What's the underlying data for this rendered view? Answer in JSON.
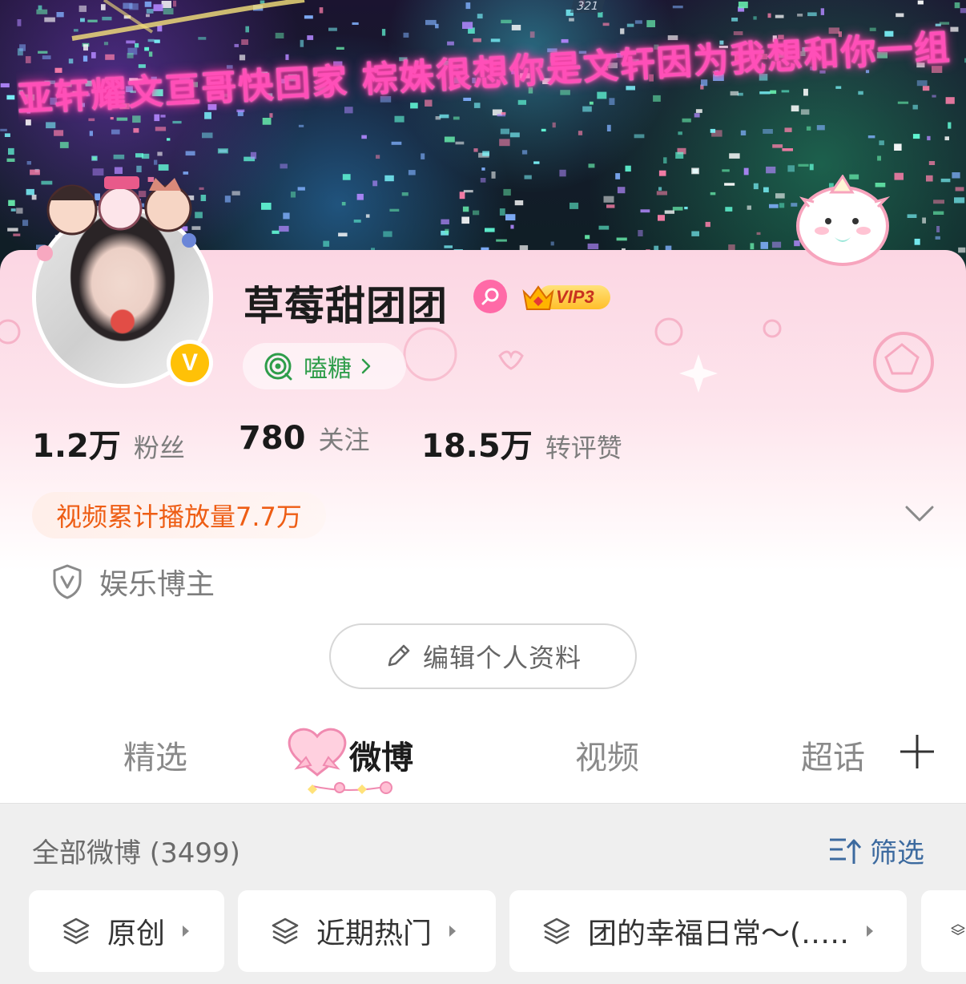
{
  "banner": {
    "slogan": "亚轩耀文亘哥快回家 棕姝很想你是文轩因为我想和你一组",
    "stand_number": "321"
  },
  "profile": {
    "name": "草莓甜团团",
    "gender_icon": "female-icon",
    "vip_label": "VIP3",
    "verified_badge": "V",
    "candy_label": "嗑糖",
    "stats": [
      {
        "value": "1.2万",
        "label": "粉丝"
      },
      {
        "value": "780",
        "label": "关注"
      },
      {
        "value": "18.5万",
        "label": "转评赞"
      }
    ],
    "video_plays": "视频累计播放量7.7万",
    "role": "娱乐博主",
    "edit_button": "编辑个人资料"
  },
  "tabs": [
    {
      "label": "精选",
      "active": false
    },
    {
      "label": "微博",
      "active": true
    },
    {
      "label": "视频",
      "active": false
    },
    {
      "label": "超话",
      "active": false
    }
  ],
  "feed": {
    "title": "全部微博 (3499)",
    "filter_label": "筛选",
    "chips": [
      {
        "label": "原创"
      },
      {
        "label": "近期热门"
      },
      {
        "label": "团的幸福日常～(‥…"
      }
    ]
  },
  "colors": {
    "accent_orange": "#ee5d14",
    "candy_green": "#2e9d4a",
    "filter_blue": "#3c6a9f",
    "pink_header": "#fcd6e3",
    "vip_gold": "#ffbf2a",
    "verified_yellow": "#ffc107"
  }
}
